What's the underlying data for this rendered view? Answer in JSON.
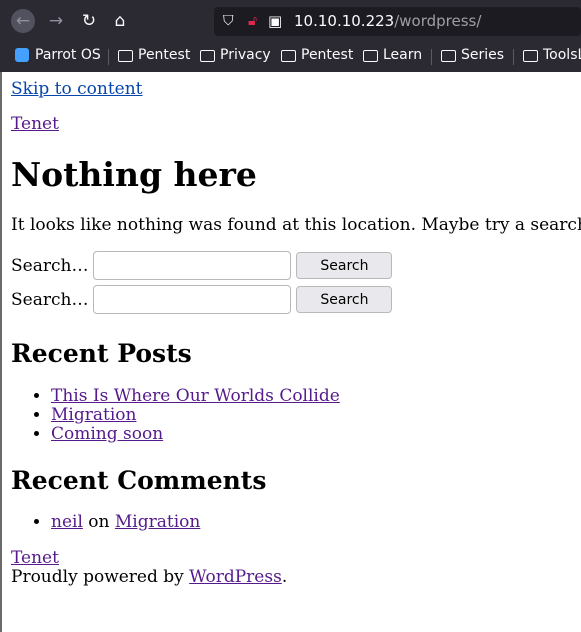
{
  "browser": {
    "url_host": "10.10.10.223",
    "url_path": "/wordpress/",
    "bookmarks": [
      "Parrot OS",
      "Pentest",
      "Privacy",
      "Pentest",
      "Learn",
      "Series",
      "ToolsL"
    ]
  },
  "page": {
    "skip_link": "Skip to content",
    "site_title": "Tenet",
    "heading": "Nothing here",
    "message": "It looks like nothing was found at this location. Maybe try a search?",
    "search_label": "Search…",
    "search_button": "Search",
    "recent_posts_heading": "Recent Posts",
    "recent_posts": [
      "This Is Where Our Worlds Collide",
      "Migration",
      "Coming soon"
    ],
    "recent_comments_heading": "Recent Comments",
    "comment": {
      "author": "neil",
      "on": "on",
      "post": "Migration"
    },
    "footer_title": "Tenet",
    "footer_text": "Proudly powered by",
    "footer_link": "WordPress",
    "footer_period": "."
  }
}
